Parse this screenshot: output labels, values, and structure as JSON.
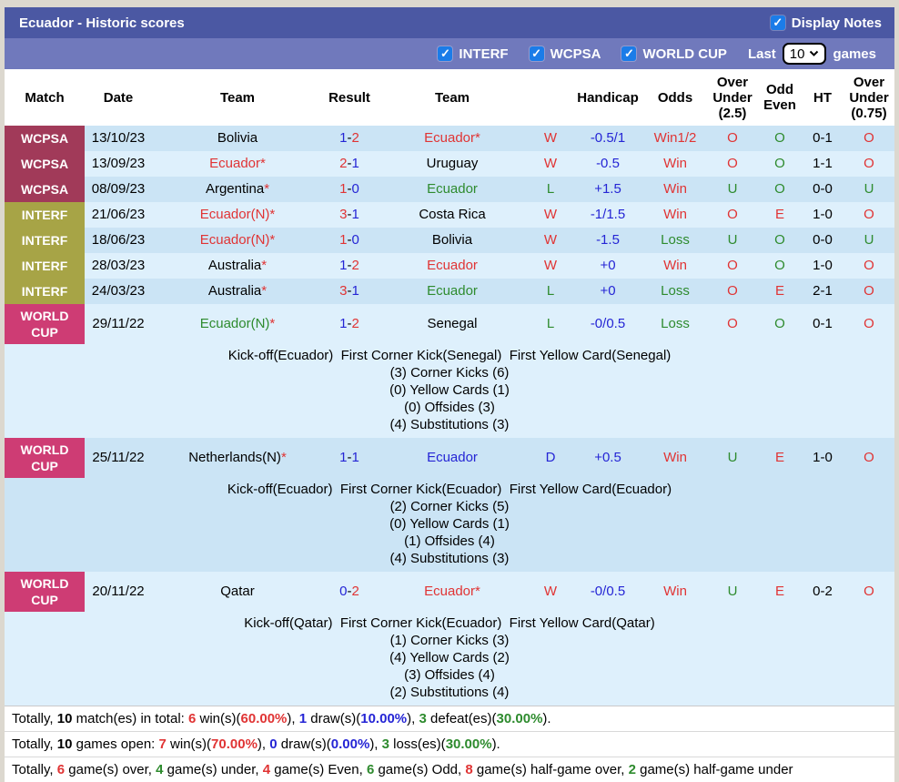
{
  "header": {
    "title": "Ecuador - Historic scores",
    "display_notes": {
      "label": "Display Notes",
      "checked": true
    }
  },
  "filter_bar": {
    "checkboxes": [
      {
        "label": "INTERF",
        "checked": true
      },
      {
        "label": "WCPSA",
        "checked": true
      },
      {
        "label": "WORLD CUP",
        "checked": true
      }
    ],
    "last_label": "Last",
    "last_value": "10",
    "games_label": "games"
  },
  "colors": {
    "title_bar": "#4b58a3",
    "filter_bar": "#7079bc",
    "checkbox_blue": "#1b7ce8",
    "wcpsa_label": "#a13a59",
    "interf_label": "#a7a446",
    "world_cup_label": "#ce3c74",
    "win_red": "#e03434",
    "loss_green": "#2e8b2e",
    "draw_blue": "#2525d5",
    "row_dark": "#cbe4f5",
    "row_light": "#def0fc"
  },
  "table": {
    "columns": [
      {
        "label": "Match"
      },
      {
        "label": "Date"
      },
      {
        "label": "Team"
      },
      {
        "label": "Result"
      },
      {
        "label": "Team"
      },
      {
        "label": ""
      },
      {
        "label": "Handicap"
      },
      {
        "label": "Odds"
      },
      {
        "label": "Over\nUnder\n(2.5)"
      },
      {
        "label": "Odd\nEven"
      },
      {
        "label": "HT"
      },
      {
        "label": "Over\nUnder\n(0.75)"
      }
    ],
    "rows": [
      {
        "competition": "WCPSA",
        "comp_key": "wcpsa",
        "stripe": "dark",
        "date": "13/10/23",
        "team1": {
          "name": "Bolivia",
          "color": "k",
          "star": false
        },
        "result": {
          "left": "1",
          "left_color": "b",
          "right": "2",
          "right_color": "r"
        },
        "team2": {
          "name": "Ecuador",
          "color": "r",
          "star": true
        },
        "outcome": {
          "text": "W",
          "color": "r"
        },
        "handicap": {
          "text": "-0.5/1",
          "color": "b"
        },
        "odds": {
          "text": "Win1/2",
          "color": "r"
        },
        "over_under_25": {
          "text": "O",
          "color": "r"
        },
        "odd_even": {
          "text": "O",
          "color": "g"
        },
        "ht": {
          "text": "0-1",
          "color": "k"
        },
        "over_under_075": {
          "text": "O",
          "color": "r"
        },
        "notes": null
      },
      {
        "competition": "WCPSA",
        "comp_key": "wcpsa",
        "stripe": "light",
        "date": "13/09/23",
        "team1": {
          "name": "Ecuador",
          "color": "r",
          "star": true
        },
        "result": {
          "left": "2",
          "left_color": "r",
          "right": "1",
          "right_color": "b"
        },
        "team2": {
          "name": "Uruguay",
          "color": "k",
          "star": false
        },
        "outcome": {
          "text": "W",
          "color": "r"
        },
        "handicap": {
          "text": "-0.5",
          "color": "b"
        },
        "odds": {
          "text": "Win",
          "color": "r"
        },
        "over_under_25": {
          "text": "O",
          "color": "r"
        },
        "odd_even": {
          "text": "O",
          "color": "g"
        },
        "ht": {
          "text": "1-1",
          "color": "k"
        },
        "over_under_075": {
          "text": "O",
          "color": "r"
        },
        "notes": null
      },
      {
        "competition": "WCPSA",
        "comp_key": "wcpsa",
        "stripe": "dark",
        "date": "08/09/23",
        "team1": {
          "name": "Argentina",
          "color": "k",
          "star": true
        },
        "result": {
          "left": "1",
          "left_color": "r",
          "right": "0",
          "right_color": "b"
        },
        "team2": {
          "name": "Ecuador",
          "color": "g",
          "star": false
        },
        "outcome": {
          "text": "L",
          "color": "g"
        },
        "handicap": {
          "text": "+1.5",
          "color": "b"
        },
        "odds": {
          "text": "Win",
          "color": "r"
        },
        "over_under_25": {
          "text": "U",
          "color": "g"
        },
        "odd_even": {
          "text": "O",
          "color": "g"
        },
        "ht": {
          "text": "0-0",
          "color": "k"
        },
        "over_under_075": {
          "text": "U",
          "color": "g"
        },
        "notes": null
      },
      {
        "competition": "INTERF",
        "comp_key": "interf",
        "stripe": "light",
        "date": "21/06/23",
        "team1": {
          "name": "Ecuador(N)",
          "color": "r",
          "star": true
        },
        "result": {
          "left": "3",
          "left_color": "r",
          "right": "1",
          "right_color": "b"
        },
        "team2": {
          "name": "Costa Rica",
          "color": "k",
          "star": false
        },
        "outcome": {
          "text": "W",
          "color": "r"
        },
        "handicap": {
          "text": "-1/1.5",
          "color": "b"
        },
        "odds": {
          "text": "Win",
          "color": "r"
        },
        "over_under_25": {
          "text": "O",
          "color": "r"
        },
        "odd_even": {
          "text": "E",
          "color": "r"
        },
        "ht": {
          "text": "1-0",
          "color": "k"
        },
        "over_under_075": {
          "text": "O",
          "color": "r"
        },
        "notes": null
      },
      {
        "competition": "INTERF",
        "comp_key": "interf",
        "stripe": "dark",
        "date": "18/06/23",
        "team1": {
          "name": "Ecuador(N)",
          "color": "r",
          "star": true
        },
        "result": {
          "left": "1",
          "left_color": "r",
          "right": "0",
          "right_color": "b"
        },
        "team2": {
          "name": "Bolivia",
          "color": "k",
          "star": false
        },
        "outcome": {
          "text": "W",
          "color": "r"
        },
        "handicap": {
          "text": "-1.5",
          "color": "b"
        },
        "odds": {
          "text": "Loss",
          "color": "g"
        },
        "over_under_25": {
          "text": "U",
          "color": "g"
        },
        "odd_even": {
          "text": "O",
          "color": "g"
        },
        "ht": {
          "text": "0-0",
          "color": "k"
        },
        "over_under_075": {
          "text": "U",
          "color": "g"
        },
        "notes": null
      },
      {
        "competition": "INTERF",
        "comp_key": "interf",
        "stripe": "light",
        "date": "28/03/23",
        "team1": {
          "name": "Australia",
          "color": "k",
          "star": true
        },
        "result": {
          "left": "1",
          "left_color": "b",
          "right": "2",
          "right_color": "r"
        },
        "team2": {
          "name": "Ecuador",
          "color": "r",
          "star": false
        },
        "outcome": {
          "text": "W",
          "color": "r"
        },
        "handicap": {
          "text": "+0",
          "color": "b"
        },
        "odds": {
          "text": "Win",
          "color": "r"
        },
        "over_under_25": {
          "text": "O",
          "color": "r"
        },
        "odd_even": {
          "text": "O",
          "color": "g"
        },
        "ht": {
          "text": "1-0",
          "color": "k"
        },
        "over_under_075": {
          "text": "O",
          "color": "r"
        },
        "notes": null
      },
      {
        "competition": "INTERF",
        "comp_key": "interf",
        "stripe": "dark",
        "date": "24/03/23",
        "team1": {
          "name": "Australia",
          "color": "k",
          "star": true
        },
        "result": {
          "left": "3",
          "left_color": "r",
          "right": "1",
          "right_color": "b"
        },
        "team2": {
          "name": "Ecuador",
          "color": "g",
          "star": false
        },
        "outcome": {
          "text": "L",
          "color": "g"
        },
        "handicap": {
          "text": "+0",
          "color": "b"
        },
        "odds": {
          "text": "Loss",
          "color": "g"
        },
        "over_under_25": {
          "text": "O",
          "color": "r"
        },
        "odd_even": {
          "text": "E",
          "color": "r"
        },
        "ht": {
          "text": "2-1",
          "color": "k"
        },
        "over_under_075": {
          "text": "O",
          "color": "r"
        },
        "notes": null
      },
      {
        "competition": "WORLD CUP",
        "comp_key": "world_cup",
        "stripe": "light",
        "date": "29/11/22",
        "team1": {
          "name": "Ecuador(N)",
          "color": "g",
          "star": true
        },
        "result": {
          "left": "1",
          "left_color": "b",
          "right": "2",
          "right_color": "r"
        },
        "team2": {
          "name": "Senegal",
          "color": "k",
          "star": false
        },
        "outcome": {
          "text": "L",
          "color": "g"
        },
        "handicap": {
          "text": "-0/0.5",
          "color": "b"
        },
        "odds": {
          "text": "Loss",
          "color": "g"
        },
        "over_under_25": {
          "text": "O",
          "color": "r"
        },
        "odd_even": {
          "text": "O",
          "color": "g"
        },
        "ht": {
          "text": "0-1",
          "color": "k"
        },
        "over_under_075": {
          "text": "O",
          "color": "r"
        },
        "notes": {
          "headline": "Kick-off(Ecuador)  First Corner Kick(Senegal)  First Yellow Card(Senegal)",
          "lines": [
            "(3) Corner Kicks (6)",
            "(0) Yellow Cards (1)",
            "(0) Offsides (3)",
            "(4) Substitutions (3)"
          ]
        }
      },
      {
        "competition": "WORLD CUP",
        "comp_key": "world_cup",
        "stripe": "dark",
        "date": "25/11/22",
        "team1": {
          "name": "Netherlands(N)",
          "color": "k",
          "star": true
        },
        "result": {
          "left": "1",
          "left_color": "b",
          "right": "1",
          "right_color": "b"
        },
        "team2": {
          "name": "Ecuador",
          "color": "b",
          "star": false
        },
        "outcome": {
          "text": "D",
          "color": "b"
        },
        "handicap": {
          "text": "+0.5",
          "color": "b"
        },
        "odds": {
          "text": "Win",
          "color": "r"
        },
        "over_under_25": {
          "text": "U",
          "color": "g"
        },
        "odd_even": {
          "text": "E",
          "color": "r"
        },
        "ht": {
          "text": "1-0",
          "color": "k"
        },
        "over_under_075": {
          "text": "O",
          "color": "r"
        },
        "notes": {
          "headline": "Kick-off(Ecuador)  First Corner Kick(Ecuador)  First Yellow Card(Ecuador)",
          "lines": [
            "(2) Corner Kicks (5)",
            "(0) Yellow Cards (1)",
            "(1) Offsides (4)",
            "(4) Substitutions (3)"
          ]
        }
      },
      {
        "competition": "WORLD CUP",
        "comp_key": "world_cup",
        "stripe": "light",
        "date": "20/11/22",
        "team1": {
          "name": "Qatar",
          "color": "k",
          "star": false
        },
        "result": {
          "left": "0",
          "left_color": "b",
          "right": "2",
          "right_color": "r"
        },
        "team2": {
          "name": "Ecuador",
          "color": "r",
          "star": true
        },
        "outcome": {
          "text": "W",
          "color": "r"
        },
        "handicap": {
          "text": "-0/0.5",
          "color": "b"
        },
        "odds": {
          "text": "Win",
          "color": "r"
        },
        "over_under_25": {
          "text": "U",
          "color": "g"
        },
        "odd_even": {
          "text": "E",
          "color": "r"
        },
        "ht": {
          "text": "0-2",
          "color": "k"
        },
        "over_under_075": {
          "text": "O",
          "color": "r"
        },
        "notes": {
          "headline": "Kick-off(Qatar)  First Corner Kick(Ecuador)  First Yellow Card(Qatar)",
          "lines": [
            "(1) Corner Kicks (3)",
            "(4) Yellow Cards (2)",
            "(3) Offsides (4)",
            "(2) Substitutions (4)"
          ]
        }
      }
    ]
  },
  "summary_lines": [
    [
      {
        "text": "Totally, ",
        "color": "k",
        "bold": false
      },
      {
        "text": "10",
        "color": "k",
        "bold": true
      },
      {
        "text": " match(es) in total: ",
        "color": "k",
        "bold": false
      },
      {
        "text": "6",
        "color": "r",
        "bold": true
      },
      {
        "text": " win(s)(",
        "color": "k",
        "bold": false
      },
      {
        "text": "60.00%",
        "color": "r",
        "bold": true
      },
      {
        "text": "), ",
        "color": "k",
        "bold": false
      },
      {
        "text": "1",
        "color": "b",
        "bold": true
      },
      {
        "text": " draw(s)(",
        "color": "k",
        "bold": false
      },
      {
        "text": "10.00%",
        "color": "b",
        "bold": true
      },
      {
        "text": "), ",
        "color": "k",
        "bold": false
      },
      {
        "text": "3",
        "color": "g",
        "bold": true
      },
      {
        "text": " defeat(es)(",
        "color": "k",
        "bold": false
      },
      {
        "text": "30.00%",
        "color": "g",
        "bold": true
      },
      {
        "text": ").",
        "color": "k",
        "bold": false
      }
    ],
    [
      {
        "text": "Totally, ",
        "color": "k",
        "bold": false
      },
      {
        "text": "10",
        "color": "k",
        "bold": true
      },
      {
        "text": " games open: ",
        "color": "k",
        "bold": false
      },
      {
        "text": "7",
        "color": "r",
        "bold": true
      },
      {
        "text": " win(s)(",
        "color": "k",
        "bold": false
      },
      {
        "text": "70.00%",
        "color": "r",
        "bold": true
      },
      {
        "text": "), ",
        "color": "k",
        "bold": false
      },
      {
        "text": "0",
        "color": "b",
        "bold": true
      },
      {
        "text": " draw(s)(",
        "color": "k",
        "bold": false
      },
      {
        "text": "0.00%",
        "color": "b",
        "bold": true
      },
      {
        "text": "), ",
        "color": "k",
        "bold": false
      },
      {
        "text": "3",
        "color": "g",
        "bold": true
      },
      {
        "text": " loss(es)(",
        "color": "k",
        "bold": false
      },
      {
        "text": "30.00%",
        "color": "g",
        "bold": true
      },
      {
        "text": ").",
        "color": "k",
        "bold": false
      }
    ],
    [
      {
        "text": "Totally, ",
        "color": "k",
        "bold": false
      },
      {
        "text": "6",
        "color": "r",
        "bold": true
      },
      {
        "text": " game(s) over, ",
        "color": "k",
        "bold": false
      },
      {
        "text": "4",
        "color": "g",
        "bold": true
      },
      {
        "text": " game(s) under, ",
        "color": "k",
        "bold": false
      },
      {
        "text": "4",
        "color": "r",
        "bold": true
      },
      {
        "text": " game(s) Even, ",
        "color": "k",
        "bold": false
      },
      {
        "text": "6",
        "color": "g",
        "bold": true
      },
      {
        "text": " game(s) Odd, ",
        "color": "k",
        "bold": false
      },
      {
        "text": "8",
        "color": "r",
        "bold": true
      },
      {
        "text": " game(s) half-game over, ",
        "color": "k",
        "bold": false
      },
      {
        "text": "2",
        "color": "g",
        "bold": true
      },
      {
        "text": " game(s) half-game under",
        "color": "k",
        "bold": false
      }
    ]
  ]
}
